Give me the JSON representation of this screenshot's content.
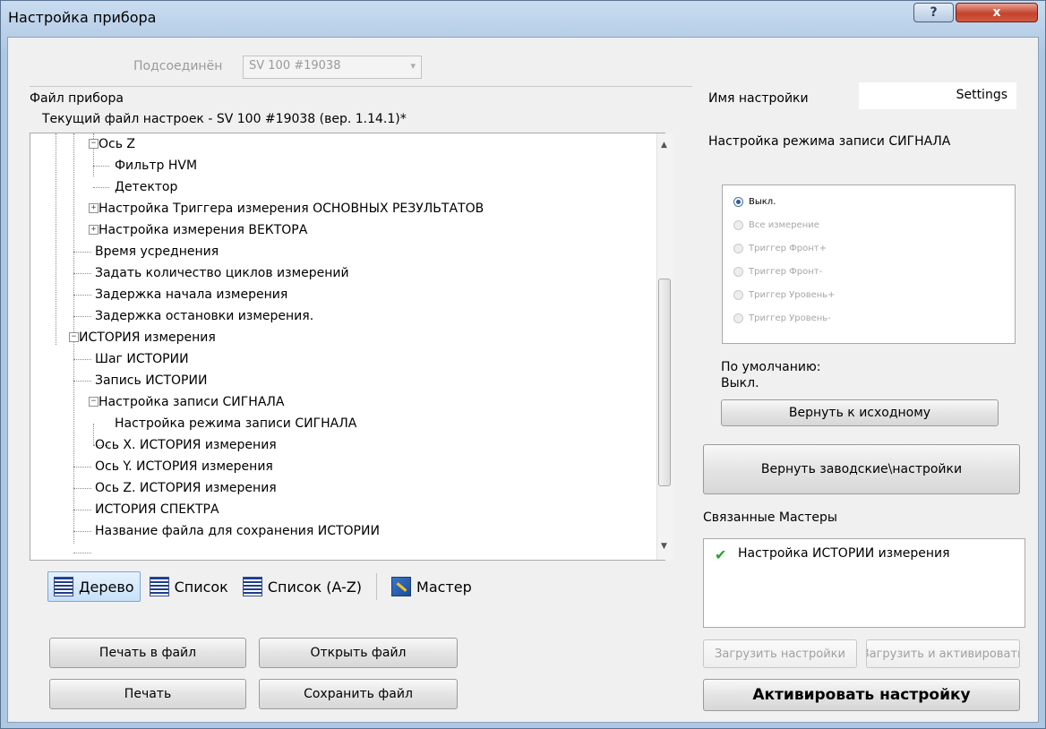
{
  "window": {
    "title": "Настройка прибора",
    "help_glyph": "?",
    "close_glyph": "x"
  },
  "connection": {
    "label": "Подсоединён",
    "device": "SV 100 #19038"
  },
  "file": {
    "group_label": "Файл прибора",
    "current_file": "Текущий файл настроек - SV 100 #19038 (вер. 1.14.1)*"
  },
  "tree": {
    "items": [
      {
        "label": "Ось Z"
      },
      {
        "label": "Фильтр HVM"
      },
      {
        "label": "Детектор"
      },
      {
        "label": "Настройка Триггера измерения ОСНОВНЫХ РЕЗУЛЬТАТОВ"
      },
      {
        "label": "Настройка измерения ВЕКТОРА"
      },
      {
        "label": "Время усреднения"
      },
      {
        "label": "Задать количество циклов измерений"
      },
      {
        "label": "Задержка начала измерения"
      },
      {
        "label": "Задержка остановки измерения."
      },
      {
        "label": "ИСТОРИЯ измерения"
      },
      {
        "label": "Шаг ИСТОРИИ"
      },
      {
        "label": "Запись ИСТОРИИ"
      },
      {
        "label": "Настройка записи СИГНАЛА"
      },
      {
        "label": "Настройка режима записи СИГНАЛА"
      },
      {
        "label": "Ось X. ИСТОРИЯ измерения"
      },
      {
        "label": "Ось Y. ИСТОРИЯ измерения"
      },
      {
        "label": "Ось Z. ИСТОРИЯ измерения"
      },
      {
        "label": "ИСТОРИЯ СПЕКТРА"
      },
      {
        "label": "Название файла для сохранения ИСТОРИИ"
      }
    ]
  },
  "view_modes": {
    "tree": "Дерево",
    "list": "Список",
    "list_az": "Список (A-Z)",
    "wizard": "Мастер"
  },
  "buttons": {
    "print_to_file": "Печать в файл",
    "open_file": "Открыть файл",
    "print": "Печать",
    "save_file": "Сохранить файл",
    "reset_default": "Вернуть к исходному",
    "factory_reset": "Вернуть заводские\\настройки",
    "load_settings": "Загрузить настройки",
    "load_and_activate": "Загрузить и активировать",
    "activate": "Активировать настройку"
  },
  "settings_panel": {
    "name_label": "Имя настройки",
    "name_value": "Settings",
    "section_title": "Настройка режима записи СИГНАЛА",
    "options": [
      {
        "label": "Выкл.",
        "selected": true
      },
      {
        "label": "Все измерение",
        "selected": false
      },
      {
        "label": "Триггер Фронт+",
        "selected": false
      },
      {
        "label": "Триггер Фронт-",
        "selected": false
      },
      {
        "label": "Триггер Уровень+",
        "selected": false
      },
      {
        "label": "Триггер Уровень-",
        "selected": false
      }
    ],
    "default_label": "По умолчанию:",
    "default_value": "Выкл."
  },
  "masters": {
    "title": "Связанные Мастеры",
    "items": [
      {
        "label": "Настройка ИСТОРИИ измерения",
        "icon": "check-icon"
      }
    ]
  },
  "colors": {
    "title_bar": "#aec7e3",
    "close_button": "#c4422e",
    "check": "#28a428"
  }
}
